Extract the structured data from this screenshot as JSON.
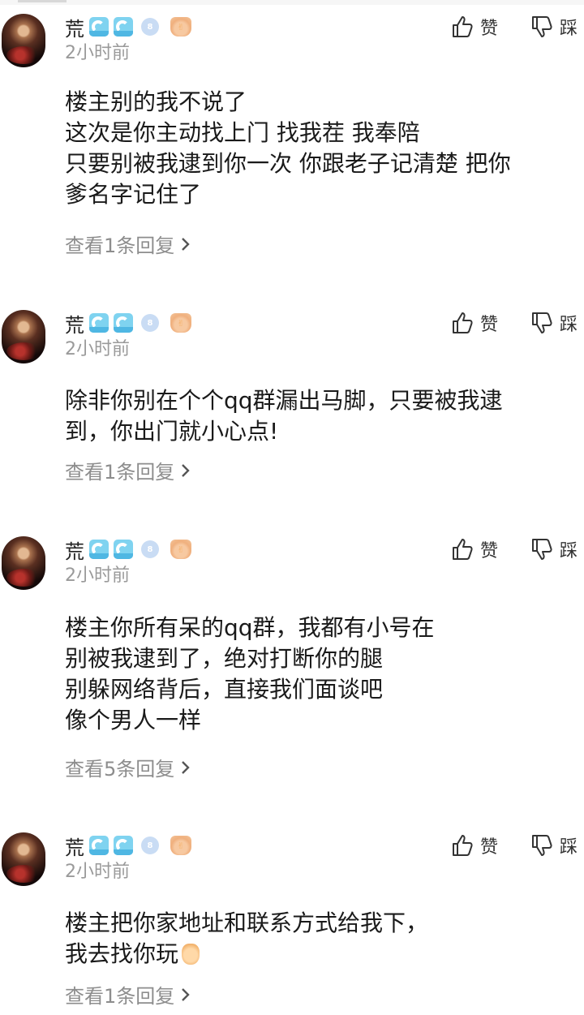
{
  "comments": [
    {
      "username": "荒",
      "time": "2小时前",
      "gem_level": "8",
      "like_label": "赞",
      "dislike_label": "踩",
      "lines": [
        "楼主别的我不说了",
        "这次是你主动找上门 找我茬 我奉陪",
        "只要别被我逮到你一次 你跟老子记清楚 把你",
        "爹名字记住了"
      ],
      "replies": "查看1条回复"
    },
    {
      "username": "荒",
      "time": "2小时前",
      "gem_level": "8",
      "like_label": "赞",
      "dislike_label": "踩",
      "lines": [
        "除非你别在个个qq群漏出马脚，只要被我逮",
        "到，你出门就小心点!"
      ],
      "replies": "查看1条回复"
    },
    {
      "username": "荒",
      "time": "2小时前",
      "gem_level": "8",
      "like_label": "赞",
      "dislike_label": "踩",
      "lines": [
        "楼主你所有呆的qq群，我都有小号在",
        "别被我逮到了，绝对打断你的腿",
        "别躲网络背后，直接我们面谈吧",
        "像个男人一样"
      ],
      "replies": "查看5条回复"
    },
    {
      "username": "荒",
      "time": "2小时前",
      "gem_level": "8",
      "like_label": "赞",
      "dislike_label": "踩",
      "lines": [
        "楼主把你家地址和联系方式给我下，",
        "我去找你玩"
      ],
      "replies": "查看1条回复"
    }
  ],
  "icons": {
    "badge": "wave-badge-icon",
    "level": "gem-icon",
    "like": "thumbs-up-icon",
    "dislike": "thumbs-down-icon",
    "chevron": "chevron-right-icon",
    "emoji": "ok-hand-emoji-icon"
  },
  "colors": {
    "text": "#1a1a1a",
    "secondary": "#9a9a9a",
    "badge": "#7fd3f0"
  }
}
